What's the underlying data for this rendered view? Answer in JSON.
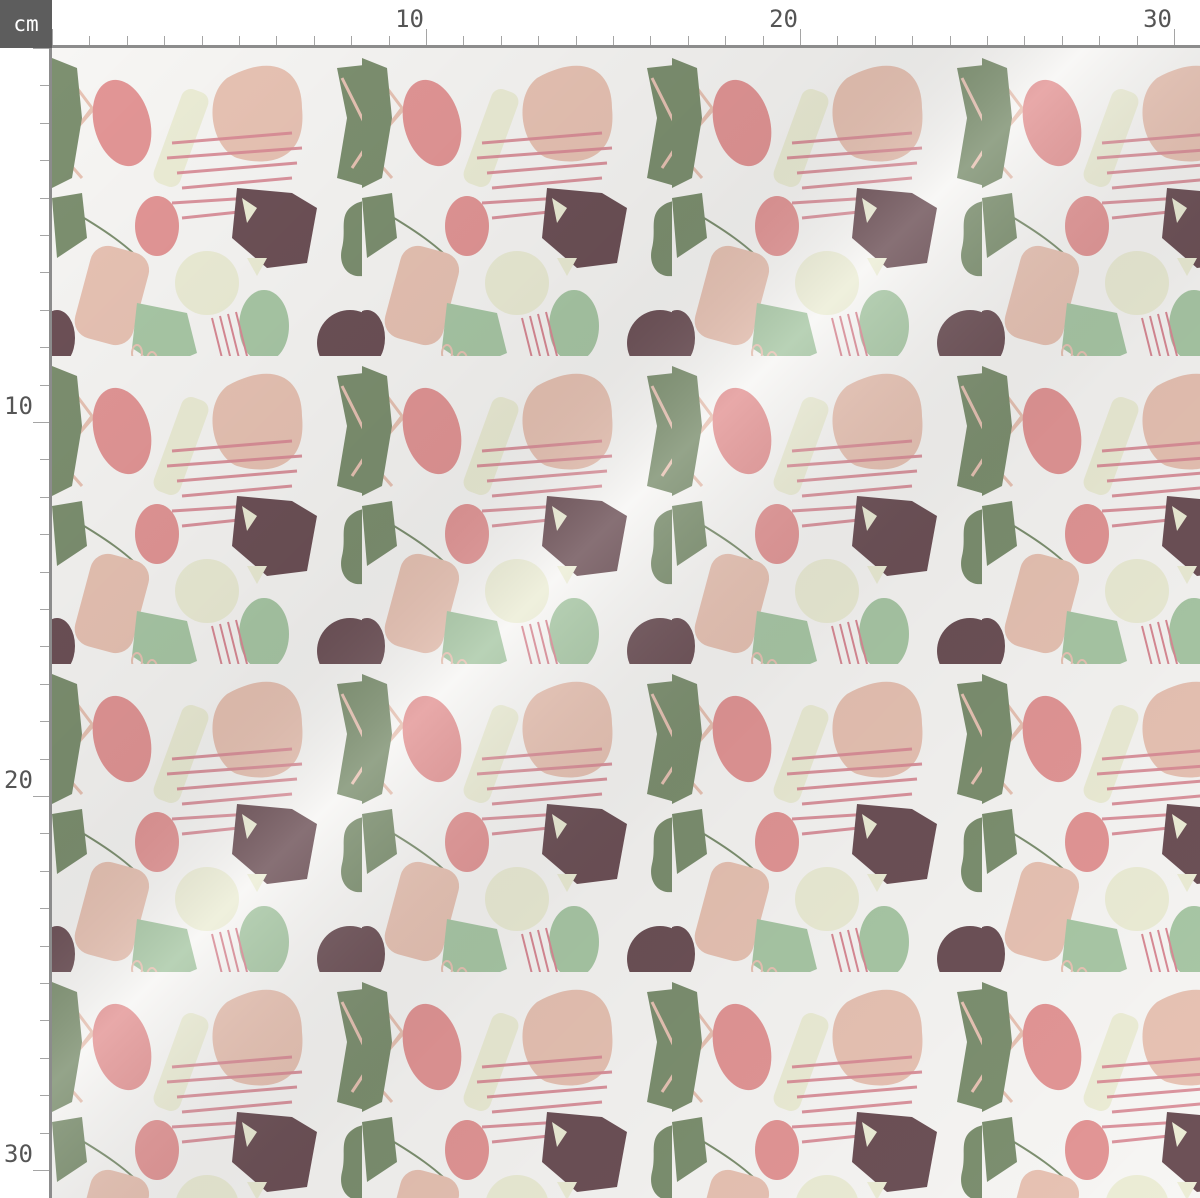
{
  "unit_label": "cm",
  "ruler": {
    "top_labels": [
      {
        "text": "10",
        "cm": 10
      },
      {
        "text": "20",
        "cm": 20
      },
      {
        "text": "30",
        "cm": 30
      }
    ],
    "left_labels": [
      {
        "text": "10",
        "cm": 10
      },
      {
        "text": "20",
        "cm": 20
      },
      {
        "text": "30",
        "cm": 30
      }
    ]
  },
  "palette": {
    "background": "#f7f6f4",
    "dusty_pink": "#e39696",
    "blush": "#e8c3b4",
    "sage": "#7d9070",
    "mint": "#a9c8a6",
    "plum": "#6d5157",
    "cream": "#ecedd6",
    "scribble_pink": "#d98a95"
  }
}
